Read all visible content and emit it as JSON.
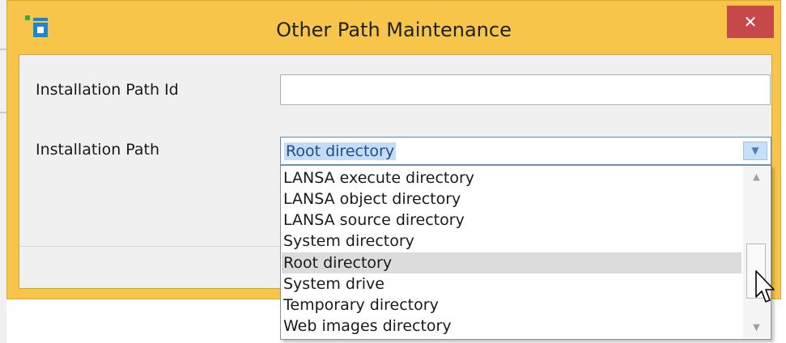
{
  "window": {
    "title": "Other Path Maintenance",
    "close_label": "✕"
  },
  "form": {
    "installation_path_id": {
      "label": "Installation Path Id",
      "value": ""
    },
    "installation_path": {
      "label": "Installation Path",
      "value": "Root directory"
    }
  },
  "dropdown": {
    "options": [
      "LANSA execute directory",
      "LANSA object directory",
      "LANSA source directory",
      "System directory",
      "Root directory",
      "System drive",
      "Temporary directory",
      "Web images directory"
    ],
    "selected": "Root directory",
    "scroll_up_icon": "▲",
    "scroll_down_icon": "▼",
    "combo_arrow_icon": "▼"
  },
  "colors": {
    "window_frame": "#f6c54a",
    "close_button": "#c74848",
    "selection_highlight": "#c6dbf4"
  }
}
